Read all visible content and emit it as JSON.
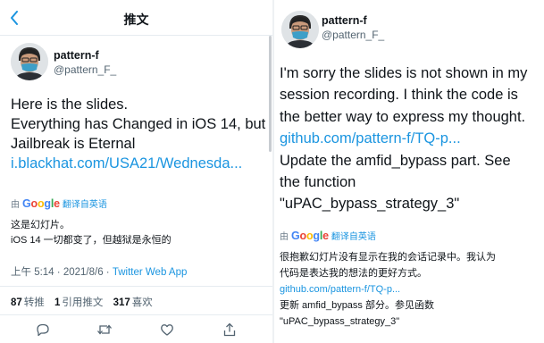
{
  "left": {
    "nav_title": "推文",
    "author": {
      "name": "pattern-f",
      "handle": "@pattern_F_"
    },
    "body_lines": [
      "Here is the slides.",
      "Everything has Changed in iOS 14, but",
      "Jailbreak is Eternal"
    ],
    "link": "i.blackhat.com/USA21/Wednesda...",
    "translate": {
      "by": "由",
      "google": [
        "G",
        "o",
        "o",
        "g",
        "l",
        "e"
      ],
      "label": "翻译自英语"
    },
    "translation_lines": [
      "这是幻灯片。",
      "iOS 14 一切都变了，但越狱是永恒的"
    ],
    "meta": {
      "time": "上午 5:14",
      "date": "2021/8/6",
      "sep": "·",
      "source": "Twitter Web App"
    },
    "stats": [
      {
        "count": "87",
        "label": "转推"
      },
      {
        "count": "1",
        "label": "引用推文"
      },
      {
        "count": "317",
        "label": "喜欢"
      }
    ],
    "actions": [
      "reply-icon",
      "retweet-icon",
      "like-icon",
      "share-icon"
    ]
  },
  "right": {
    "author": {
      "name": "pattern-f",
      "handle": "@pattern_F_"
    },
    "body_lines": [
      "I'm sorry the slides is not shown in my",
      "session recording. I think the code is",
      "the better way to express my thought."
    ],
    "link": "github.com/pattern-f/TQ-p...",
    "body_lines_2": [
      "Update the amfid_bypass part. See",
      "the function",
      "\"uPAC_bypass_strategy_3\""
    ],
    "translate": {
      "by": "由",
      "google": [
        "G",
        "o",
        "o",
        "g",
        "l",
        "e"
      ],
      "label": "翻译自英语"
    },
    "translation_lines": [
      "很抱歉幻灯片没有显示在我的会话记录中。我认为",
      "代码是表达我的想法的更好方式。"
    ],
    "translation_link": "github.com/pattern-f/TQ-p...",
    "translation_lines_2": [
      "更新 amfid_bypass 部分。参见函数",
      "\"uPAC_bypass_strategy_3\""
    ]
  },
  "colors": {
    "link": "#1b95e0",
    "text": "#0f1419",
    "muted": "#536471",
    "divider": "#e6ecf0"
  }
}
